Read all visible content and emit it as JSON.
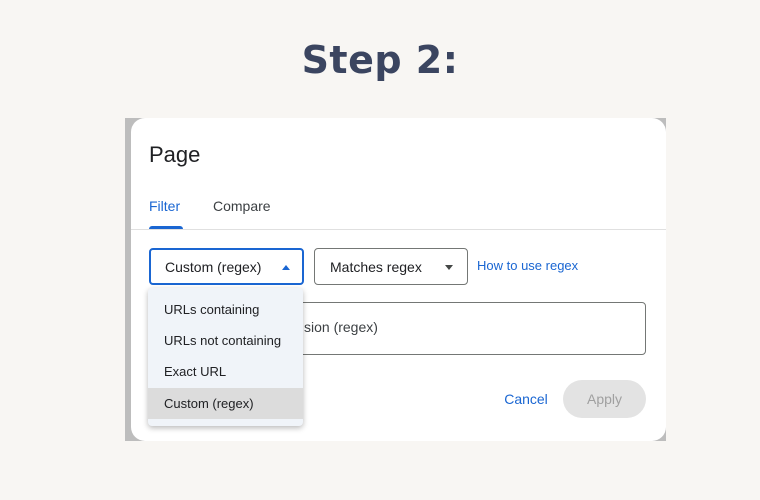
{
  "heading": "Step 2:",
  "dialog": {
    "title": "Page",
    "tabs": [
      {
        "label": "Filter",
        "active": true
      },
      {
        "label": "Compare",
        "active": false
      }
    ],
    "match_type_select": {
      "value": "Custom (regex)",
      "expanded": true
    },
    "operator_select": {
      "value": "Matches regex"
    },
    "help_link": "How to use regex",
    "expression_input": {
      "visible_text": "sion (regex)"
    },
    "cancel_label": "Cancel",
    "apply_label": "Apply"
  },
  "dropdown": {
    "options": [
      {
        "label": "URLs containing"
      },
      {
        "label": "URLs not containing"
      },
      {
        "label": "Exact URL"
      },
      {
        "label": "Custom (regex)",
        "selected": true
      }
    ]
  },
  "colors": {
    "accent": "#1a66d2",
    "heading": "#3b4560",
    "background": "#f8f6f3"
  }
}
